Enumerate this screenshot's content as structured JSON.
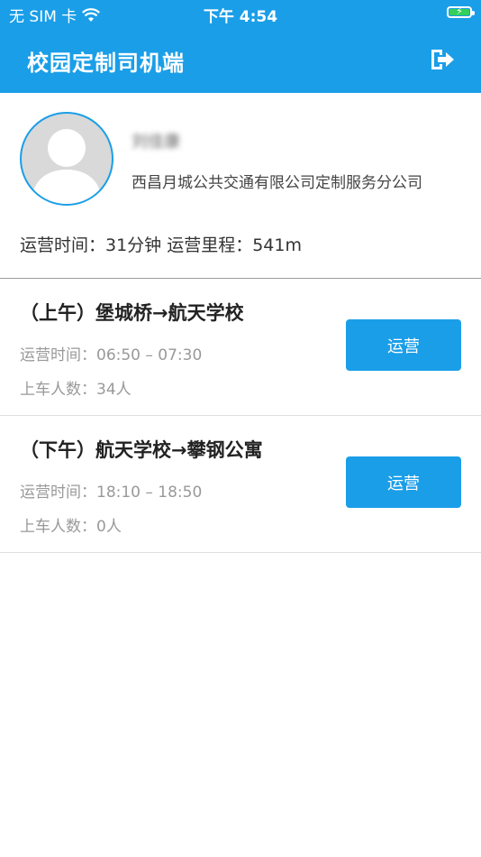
{
  "status_bar": {
    "carrier": "无 SIM 卡",
    "time": "下午 4:54"
  },
  "header": {
    "title": "校园定制司机端",
    "logout_icon": "logout-icon"
  },
  "profile": {
    "name": "刘佳康",
    "company": "西昌月城公共交通有限公司定制服务分公司",
    "stats": "运营时间：31分钟  运营里程：541m"
  },
  "routes": [
    {
      "title": "（上午）堡城桥→航天学校",
      "time": "运营时间：06:50 – 07:30",
      "count": "上车人数：34人",
      "button": "运营"
    },
    {
      "title": "（下午）航天学校→攀钢公寓",
      "time": "运营时间：18:10 – 18:50",
      "count": "上车人数：0人",
      "button": "运营"
    }
  ],
  "colors": {
    "primary": "#1a9ee8",
    "battery": "#34d05a"
  }
}
